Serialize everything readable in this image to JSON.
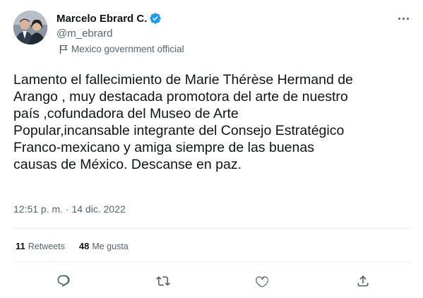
{
  "author": {
    "display_name": "Marcelo Ebrard C.",
    "handle": "@m_ebrard",
    "verified_icon": "verified-badge-icon",
    "label": "Mexico government official"
  },
  "tweet": {
    "text": "Lamento el fallecimiento de Marie Thérèse Hermand de\nArango , muy destacada promotora del arte de nuestro\npaís ,cofundadora del Museo de Arte\nPopular,incansable integrante del Consejo Estratégico\nFranco-mexicano y amiga siempre de las buenas\ncausas de México. Descanse en paz.",
    "timestamp": "12:51 p. m. · 14 dic. 2022"
  },
  "stats": {
    "retweets_count": "11",
    "retweets_label": "Retweets",
    "likes_count": "48",
    "likes_label": "Me gusta"
  },
  "actions": {
    "reply_icon": "reply-icon",
    "retweet_icon": "retweet-icon",
    "like_icon": "heart-icon",
    "share_icon": "share-icon"
  },
  "colors": {
    "text_primary": "#0f1419",
    "text_secondary": "#536471",
    "verified_blue": "#1d9bf0",
    "divider": "#eff3f4"
  }
}
